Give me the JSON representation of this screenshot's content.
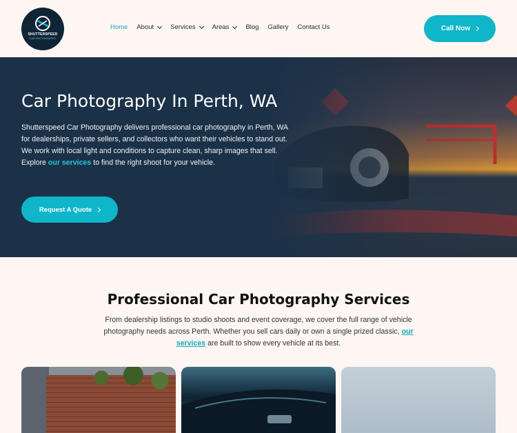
{
  "brand": {
    "logo_name": "SHUTTERSPEED",
    "logo_sub": "CAR PHOTOGRAPHY"
  },
  "nav": {
    "items": [
      {
        "label": "Home",
        "active": true,
        "dropdown": false
      },
      {
        "label": "About",
        "active": false,
        "dropdown": true
      },
      {
        "label": "Services",
        "active": false,
        "dropdown": true
      },
      {
        "label": "Areas",
        "active": false,
        "dropdown": true
      },
      {
        "label": "Blog",
        "active": false,
        "dropdown": false
      },
      {
        "label": "Gallery",
        "active": false,
        "dropdown": false
      },
      {
        "label": "Contact Us",
        "active": false,
        "dropdown": false
      }
    ],
    "cta_label": "Call Now"
  },
  "hero": {
    "title": "Car Photography In Perth, WA",
    "text_before": "Shutterspeed Car Photography delivers professional car photography in Perth, WA for dealerships, private sellers, and collectors who want their vehicles to stand out. We work with local light and conditions to capture clean, sharp images that sell. Explore ",
    "link": "our services",
    "text_after": " to find the right shoot for your vehicle.",
    "button_label": "Request A Quote"
  },
  "services": {
    "title": "Professional Car Photography Services",
    "text_before": "From dealership listings to studio shoots and event coverage, we cover the full range of vehicle photography needs across Perth. Whether you sell cars daily or own a single prized classic, ",
    "link": "our services",
    "text_after": " are built to show every vehicle at its best."
  },
  "colors": {
    "accent": "#0fb5c9",
    "hero_bg": "#1b3148",
    "page_bg": "#fdf6f3"
  }
}
